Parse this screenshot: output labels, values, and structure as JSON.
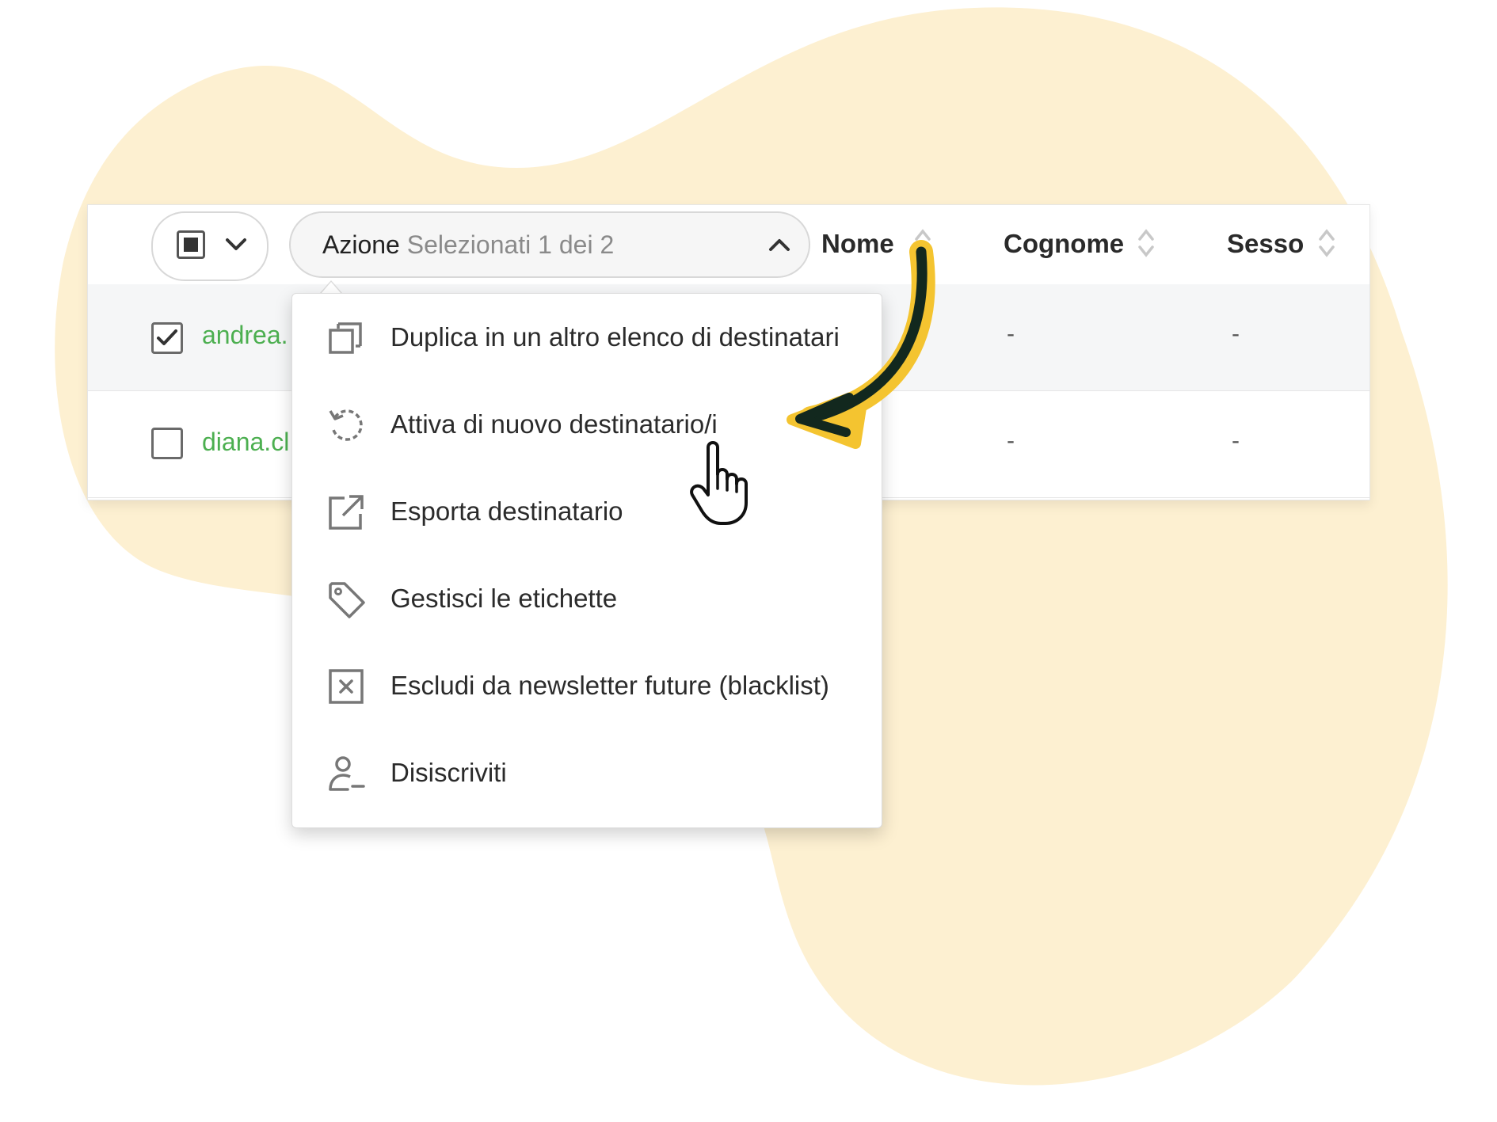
{
  "colors": {
    "blob": "#fdf0d1",
    "accent_green": "#4caf50",
    "arrow_yellow": "#f4c430",
    "arrow_dark": "#12281e"
  },
  "toolbar": {
    "action_label": "Azione",
    "selection_status": "Selezionati 1 dei 2"
  },
  "table": {
    "columns": [
      "Nome",
      "Cognome",
      "Sesso"
    ],
    "rows": [
      {
        "checked": true,
        "email": "andrea.",
        "cognome": "-",
        "sesso": "-"
      },
      {
        "checked": false,
        "email": "diana.cl",
        "cognome": "-",
        "sesso": "-"
      }
    ]
  },
  "menu": {
    "items": [
      {
        "label": "Duplica in un altro elenco di destinatari",
        "icon": "duplicate-icon"
      },
      {
        "label": "Attiva di nuovo destinatario/i",
        "icon": "reactivate-icon"
      },
      {
        "label": "Esporta destinatario",
        "icon": "export-icon"
      },
      {
        "label": "Gestisci le etichette",
        "icon": "tag-icon"
      },
      {
        "label": "Escludi da newsletter future (blacklist)",
        "icon": "blacklist-icon"
      },
      {
        "label": "Disiscriviti",
        "icon": "unsubscribe-icon"
      }
    ]
  }
}
